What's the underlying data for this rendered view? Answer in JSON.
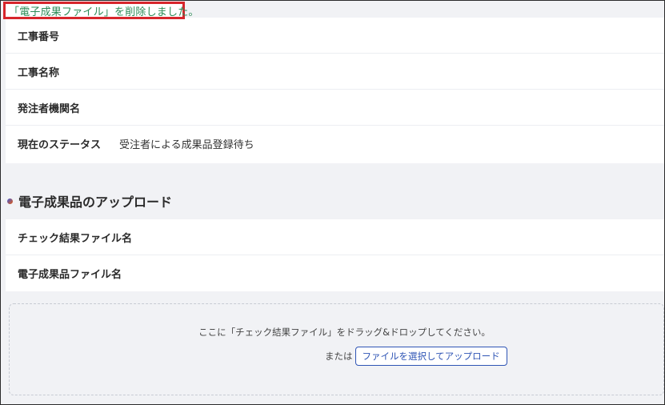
{
  "notice": {
    "message": "「電子成果ファイル」を削除しました。",
    "border_color": "#d7262c",
    "text_color": "#2e8b57"
  },
  "project_info": {
    "rows": [
      {
        "label": "工事番号",
        "value": ""
      },
      {
        "label": "工事名称",
        "value": ""
      },
      {
        "label": "発注者機関名",
        "value": ""
      },
      {
        "label": "現在のステータス",
        "value": "受注者による成果品登録待ち"
      }
    ]
  },
  "upload_section": {
    "title": "電子成果品のアップロード",
    "rows": [
      {
        "label": "チェック結果ファイル名",
        "value": ""
      },
      {
        "label": "電子成果品ファイル名",
        "value": ""
      }
    ]
  },
  "dropzone": {
    "instruction": "ここに「チェック結果ファイル」をドラッグ&ドロップしてください。",
    "or_text": "または",
    "button_label": "ファイルを選択してアップロード",
    "button_color": "#2f55b5"
  }
}
